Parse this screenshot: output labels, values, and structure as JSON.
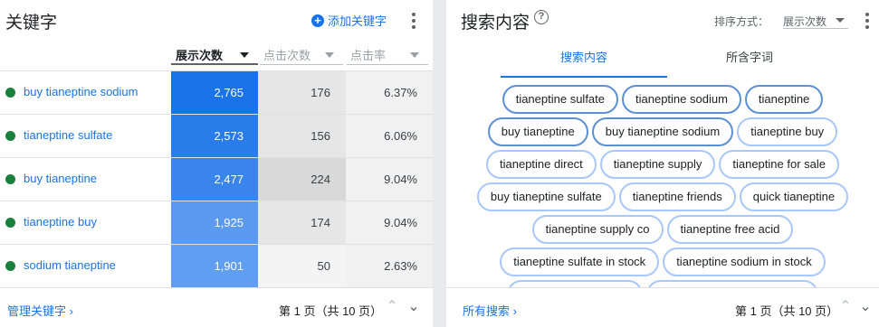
{
  "keywords_panel": {
    "title": "关键字",
    "add_label": "添加关键字",
    "columns": {
      "impressions": "展示次数",
      "clicks": "点击次数",
      "ctr": "点击率"
    },
    "rows": [
      {
        "keyword": "buy tianeptine sodium",
        "impressions": "2,765",
        "clicks": "176",
        "ctr": "6.37%"
      },
      {
        "keyword": "tianeptine sulfate",
        "impressions": "2,573",
        "clicks": "156",
        "ctr": "6.06%"
      },
      {
        "keyword": "buy tianeptine",
        "impressions": "2,477",
        "clicks": "224",
        "ctr": "9.04%"
      },
      {
        "keyword": "tianeptine buy",
        "impressions": "1,925",
        "clicks": "174",
        "ctr": "9.04%"
      },
      {
        "keyword": "sodium tianeptine",
        "impressions": "1,901",
        "clicks": "50",
        "ctr": "2.63%"
      }
    ],
    "footer_link": "管理关键字 ›",
    "pager": "第 1 页（共 10 页）"
  },
  "search_panel": {
    "title": "搜索内容",
    "sort_label": "排序方式：",
    "sort_value": "展示次数",
    "tabs": [
      "搜索内容",
      "所含字词"
    ],
    "chip_rows": [
      [
        "tianeptine sulfate",
        "tianeptine sodium",
        "tianeptine"
      ],
      [
        "buy tianeptine",
        "buy tianeptine sodium",
        "tianeptine buy"
      ],
      [
        "tianeptine direct",
        "tianeptine supply",
        "tianeptine for sale"
      ],
      [
        "buy tianeptine sulfate",
        "tianeptine friends",
        "quick tianeptine"
      ],
      [
        "tianeptine supply co",
        "tianeptine free acid"
      ],
      [
        "tianeptine sulfate in stock",
        "tianeptine sodium in stock"
      ]
    ],
    "footer_link": "所有搜索 ›",
    "pager": "第 1 页（共 10 页）"
  },
  "colors": {
    "accent": "#1a73e8",
    "status_green": "#188038"
  }
}
